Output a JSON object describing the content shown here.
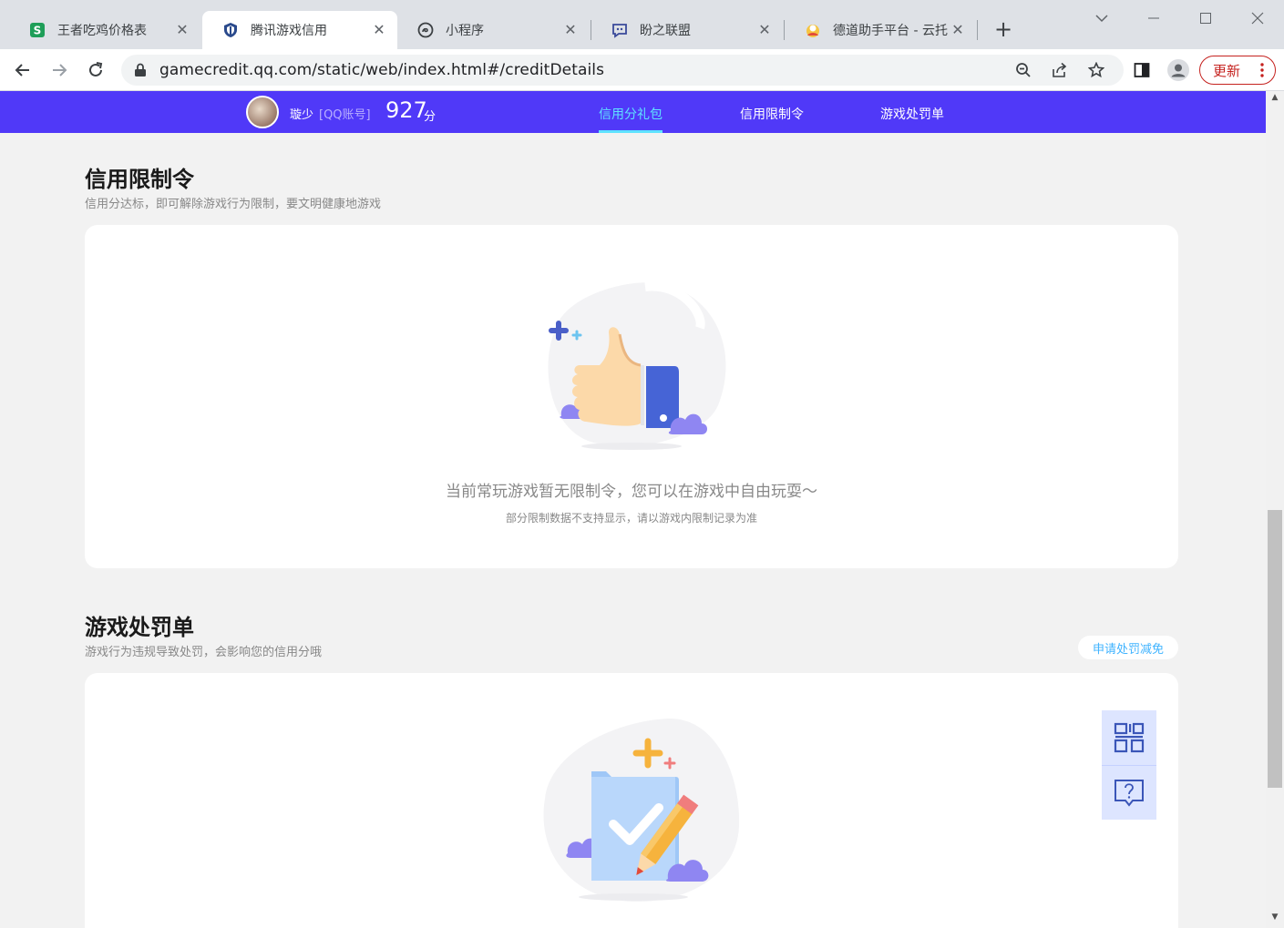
{
  "browser": {
    "tabs": [
      {
        "title": "王者吃鸡价格表",
        "icon": "sheets-icon"
      },
      {
        "title": "腾讯游戏信用",
        "icon": "tencent-shield-icon",
        "active": true
      },
      {
        "title": "小程序",
        "icon": "miniprogram-icon"
      },
      {
        "title": "盼之联盟",
        "icon": "pan-alliance-icon"
      },
      {
        "title": "德道助手平台 - 云托",
        "icon": "dedao-icon"
      }
    ],
    "url": "gamecredit.qq.com/static/web/index.html#/creditDetails",
    "update_label": "更新"
  },
  "site": {
    "user": {
      "name": "璇少",
      "account_type": "[QQ账号]",
      "score": "927",
      "score_unit": "分"
    },
    "nav": [
      {
        "label": "信用分礼包",
        "active": true
      },
      {
        "label": "信用限制令"
      },
      {
        "label": "游戏处罚单"
      }
    ]
  },
  "restriction": {
    "title": "信用限制令",
    "subtitle": "信用分达标，即可解除游戏行为限制，要文明健康地游戏",
    "empty_message": "当前常玩游戏暂无限制令，您可以在游戏中自由玩耍～",
    "empty_note": "部分限制数据不支持显示，请以游戏内限制记录为准"
  },
  "penalty": {
    "title": "游戏处罚单",
    "subtitle": "游戏行为违规导致处罚，会影响您的信用分哦",
    "appeal_label": "申请处罚减免"
  },
  "floating": [
    "qr-code-icon",
    "help-feedback-icon"
  ],
  "colors": {
    "nav_bg": "#5039f8",
    "nav_active": "#5fe3ff",
    "update_red": "#c5221f",
    "appeal_blue": "#3fb3ff"
  }
}
